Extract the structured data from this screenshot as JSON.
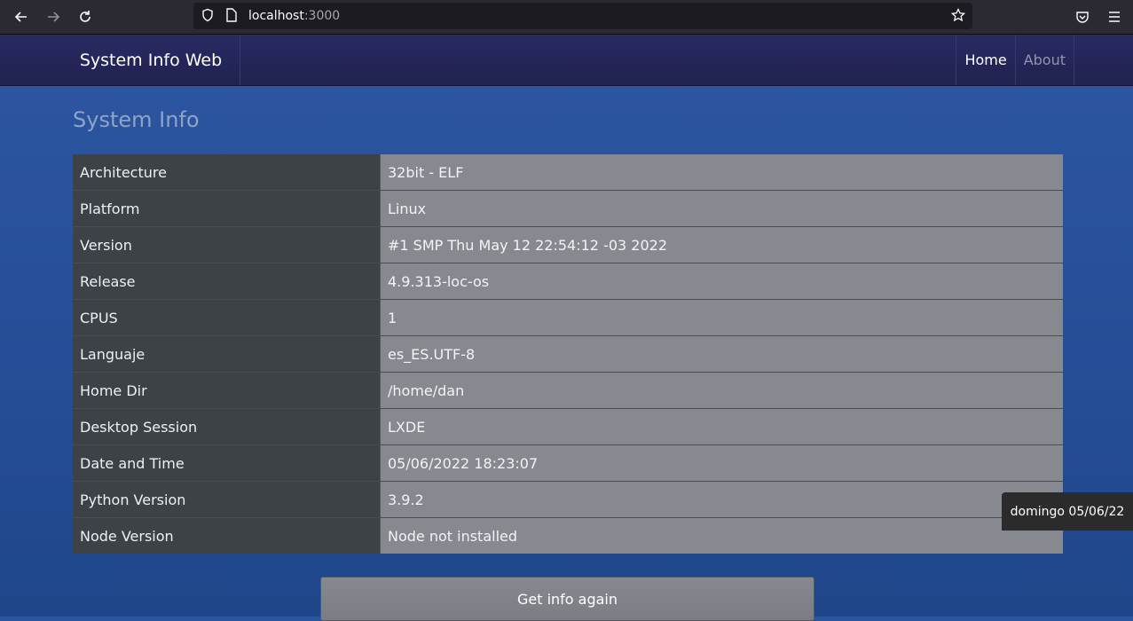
{
  "browser": {
    "url_host": "localhost",
    "url_port": ":3000",
    "icons": [
      "back-arrow-icon",
      "forward-arrow-icon",
      "reload-icon",
      "shield-icon",
      "page-icon",
      "star-icon",
      "pocket-icon",
      "menu-icon"
    ]
  },
  "navbar": {
    "brand": "System Info Web",
    "links": [
      {
        "label": "Home"
      },
      {
        "label": "About"
      }
    ]
  },
  "main": {
    "title": "System Info",
    "rows": [
      {
        "key": "Architecture",
        "value": "32bit - ELF"
      },
      {
        "key": "Platform",
        "value": "Linux"
      },
      {
        "key": "Version",
        "value": "#1 SMP Thu May 12 22:54:12 -03 2022"
      },
      {
        "key": "Release",
        "value": "4.9.313-loc-os"
      },
      {
        "key": "CPUS",
        "value": "1"
      },
      {
        "key": "Languaje",
        "value": "es_ES.UTF-8"
      },
      {
        "key": "Home Dir",
        "value": "/home/dan"
      },
      {
        "key": "Desktop Session",
        "value": "LXDE"
      },
      {
        "key": "Date and Time",
        "value": "05/06/2022 18:23:07"
      },
      {
        "key": "Python Version",
        "value": "3.9.2"
      },
      {
        "key": "Node Version",
        "value": "Node not installed"
      }
    ],
    "button_label": "Get info again"
  },
  "taskbar": {
    "clock": "domingo 05/06/22"
  }
}
